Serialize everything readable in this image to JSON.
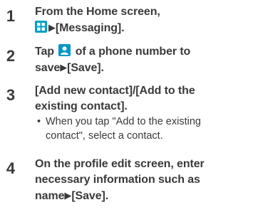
{
  "steps": [
    {
      "number": "1",
      "line1": "From the Home screen,",
      "line2_after_icon": "[Messaging].",
      "icon": "apps-grid-icon"
    },
    {
      "number": "2",
      "line1_before_icon": "Tap",
      "line1_after_icon": "of a phone number to",
      "line2": "save",
      "line2_after_arrow": "[Save].",
      "icon": "add-contact-person-icon"
    },
    {
      "number": "3",
      "line1": "[Add new contact]/[Add to the",
      "line2": "existing contact].",
      "note_bullet": "•",
      "note_line1": "When you tap \"Add to the existing",
      "note_line2": "contact\", select a contact."
    },
    {
      "number": "4",
      "line1": "On the profile edit screen, enter",
      "line2": "necessary information such as",
      "line3": "name",
      "line3_after_arrow": "[Save]."
    }
  ],
  "arrow_glyph": "▶",
  "colors": {
    "text": "#3a3a3a",
    "icon_blue": "#00a0c8"
  }
}
